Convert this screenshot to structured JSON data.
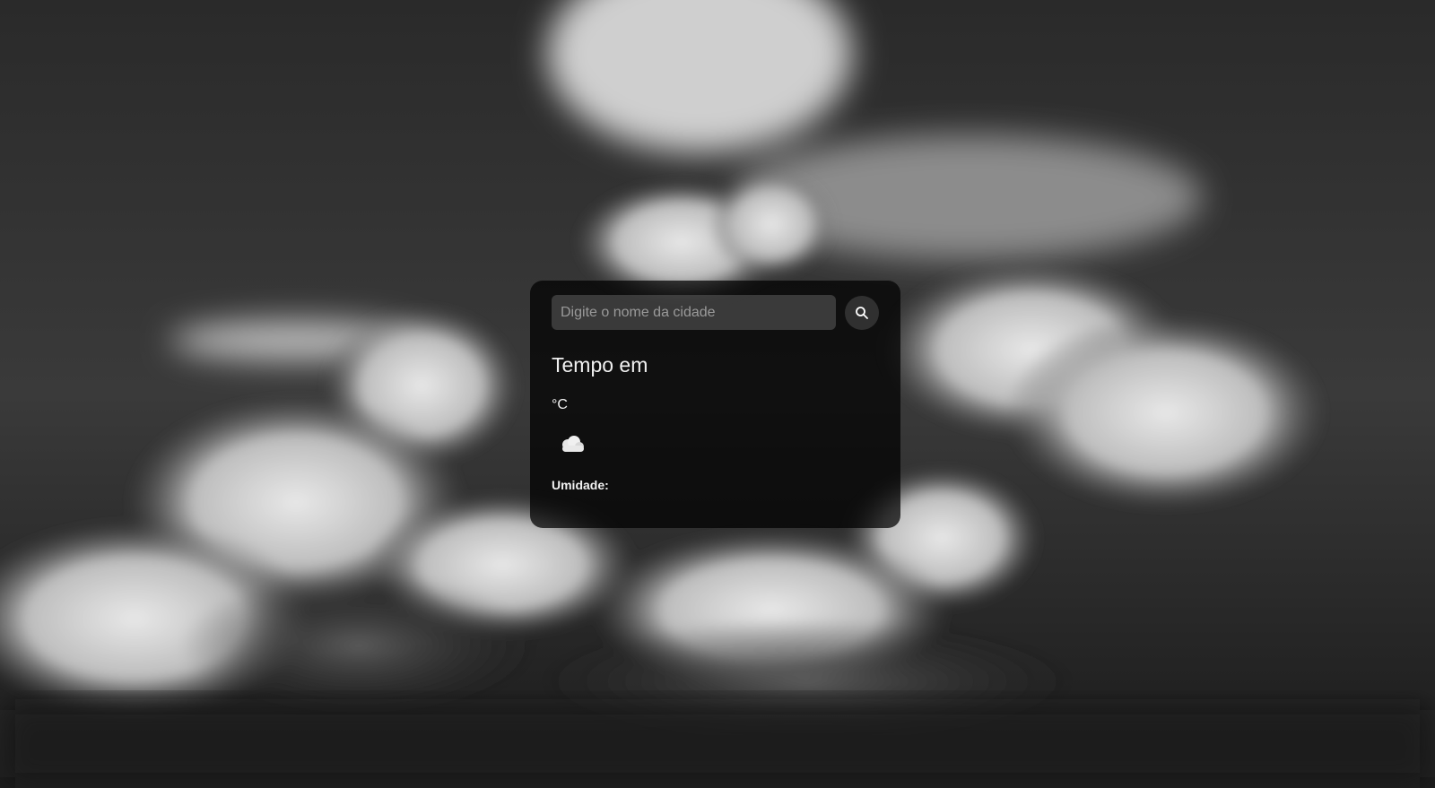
{
  "search": {
    "placeholder": "Digite o nome da cidade",
    "value": "",
    "button_icon": "search-icon"
  },
  "weather": {
    "title": "Tempo em",
    "temperature": "°C",
    "icon": "cloud-icon",
    "humidity_label": "Umidade:"
  },
  "colors": {
    "card_background": "#000000b8",
    "text": "#ffffff",
    "input_background": "#6e6e6e73"
  }
}
